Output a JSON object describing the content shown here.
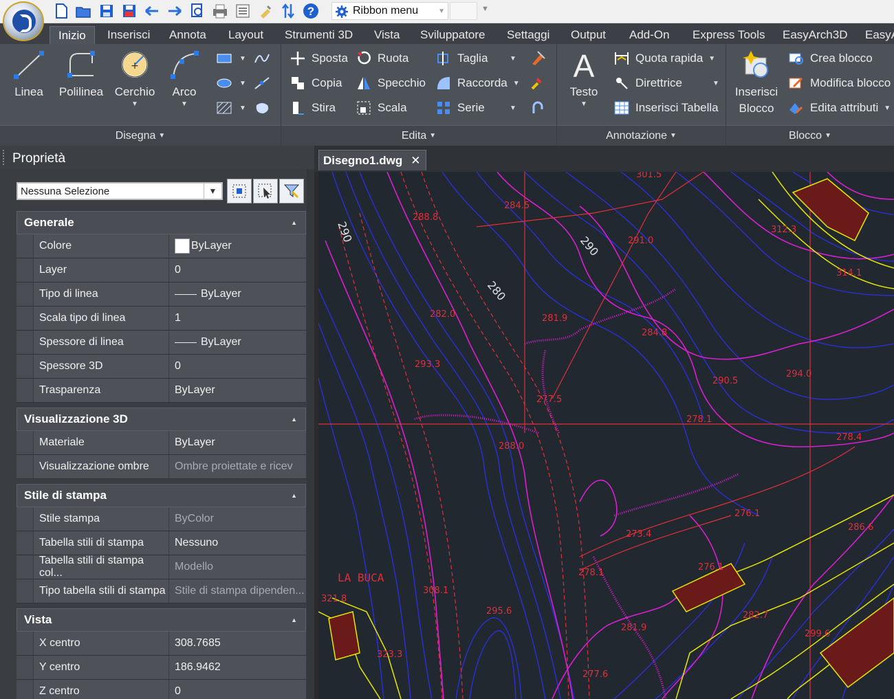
{
  "qat": {
    "title": "Ribbon menu",
    "icons": [
      "new-icon",
      "open-icon",
      "save-icon",
      "save-as-icon",
      "undo-icon",
      "redo-icon",
      "plot-preview-icon",
      "print-icon",
      "properties-icon",
      "match-properties-icon",
      "sort-icon",
      "help-icon"
    ]
  },
  "ribbon": {
    "tabs": [
      "Inizio",
      "Inserisci",
      "Annota",
      "Layout",
      "Strumenti 3D",
      "Vista",
      "Sviluppatore",
      "Settaggi",
      "Output",
      "Add-On",
      "Express Tools",
      "EasyArch3D",
      "EasyA"
    ],
    "active_tab": "Inizio",
    "draw": {
      "linea": "Linea",
      "polilinea": "Polilinea",
      "cerchio": "Cerchio",
      "arco": "Arco",
      "footer": "Disegna"
    },
    "modify": {
      "sposta": "Sposta",
      "ruota": "Ruota",
      "taglia": "Taglia",
      "copia": "Copia",
      "specchio": "Specchio",
      "raccorda": "Raccorda",
      "stira": "Stira",
      "scala": "Scala",
      "serie": "Serie",
      "footer": "Edita"
    },
    "annotation": {
      "testo": "Testo",
      "quota": "Quota rapida",
      "direttrice": "Direttrice",
      "tabella": "Inserisci Tabella",
      "footer": "Annotazione"
    },
    "block": {
      "inserisci_1": "Inserisci",
      "inserisci_2": "Blocco",
      "crea": "Crea blocco",
      "modifica": "Modifica blocco",
      "edita": "Edita attributi",
      "footer": "Blocco"
    },
    "dropdown_glyph": "▾"
  },
  "properties": {
    "title": "Proprietà",
    "selection": "Nessuna Selezione",
    "sections": {
      "generale": {
        "title": "Generale",
        "rows": [
          {
            "name": "Colore",
            "value": "ByLayer"
          },
          {
            "name": "Layer",
            "value": "0"
          },
          {
            "name": "Tipo di linea",
            "value": "ByLayer"
          },
          {
            "name": "Scala tipo di linea",
            "value": "1"
          },
          {
            "name": "Spessore di linea",
            "value": "ByLayer"
          },
          {
            "name": "Spessore 3D",
            "value": "0"
          },
          {
            "name": "Trasparenza",
            "value": "ByLayer"
          }
        ]
      },
      "vis3d": {
        "title": "Visualizzazione 3D",
        "rows": [
          {
            "name": "Materiale",
            "value": "ByLayer"
          },
          {
            "name": "Visualizzazione ombre",
            "value": "Ombre proiettate e ricev"
          }
        ]
      },
      "stampa": {
        "title": "Stile di stampa",
        "rows": [
          {
            "name": "Stile stampa",
            "value": "ByColor"
          },
          {
            "name": "Tabella stili di stampa",
            "value": "Nessuno"
          },
          {
            "name": "Tabella stili di stampa col...",
            "value": "Modello"
          },
          {
            "name": "Tipo tabella stili di stampa",
            "value": "Stile di stampa dipenden..."
          }
        ]
      },
      "vista": {
        "title": "Vista",
        "rows": [
          {
            "name": "X centro",
            "value": "308.7685"
          },
          {
            "name": "Y centro",
            "value": "186.9462"
          },
          {
            "name": "Z centro",
            "value": "0"
          }
        ]
      }
    }
  },
  "document": {
    "tab": "Disegno1.dwg",
    "close": "✕"
  },
  "drawing": {
    "place_name": "LA BUCA",
    "contour_labels": [
      "290",
      "290",
      "280"
    ],
    "elevations": [
      "301.5",
      "284.5",
      "288.8",
      "291.0",
      "312.3",
      "314.1",
      "282.0",
      "281.9",
      "284.8",
      "293.3",
      "290.5",
      "294.0",
      "277.5",
      "278.1",
      "278.4",
      "288.0",
      "276.1",
      "273.4",
      "286.6",
      "278.1",
      "276.1",
      "308.1",
      "321.8",
      "295.6",
      "282.7",
      "281.9",
      "299.6",
      "323.3",
      "277.6"
    ]
  },
  "colors": {
    "canvas_bg": "#212830",
    "contour_blue": "#2a2fd6",
    "contour_magenta": "#d91fd0",
    "red": "#e0303a",
    "yellow": "#e6e600"
  }
}
